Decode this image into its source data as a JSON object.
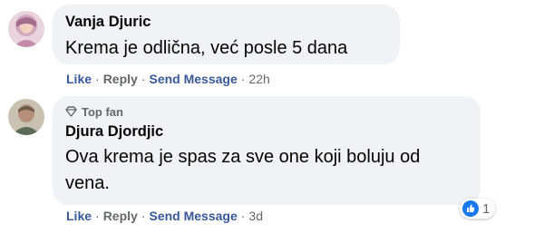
{
  "comments": [
    {
      "author": "Vanja Djuric",
      "text": "Krema je odlična, već posle 5 dana",
      "actions": {
        "like": "Like",
        "reply": "Reply",
        "send_message": "Send Message",
        "time": "22h"
      }
    },
    {
      "badge": "Top fan",
      "author": "Djura Djordjic",
      "text": "Ova krema je spas za sve one koji boluju od vena.",
      "actions": {
        "like": "Like",
        "reply": "Reply",
        "send_message": "Send Message",
        "time": "3d"
      },
      "reactions": {
        "icon": "like-reaction-icon",
        "count": "1"
      }
    }
  ],
  "separator": "·",
  "colors": {
    "bubble": "#f0f2f5",
    "link_blue": "#385898",
    "meta_gray": "#65676b",
    "like_blue": "#1877f2"
  }
}
